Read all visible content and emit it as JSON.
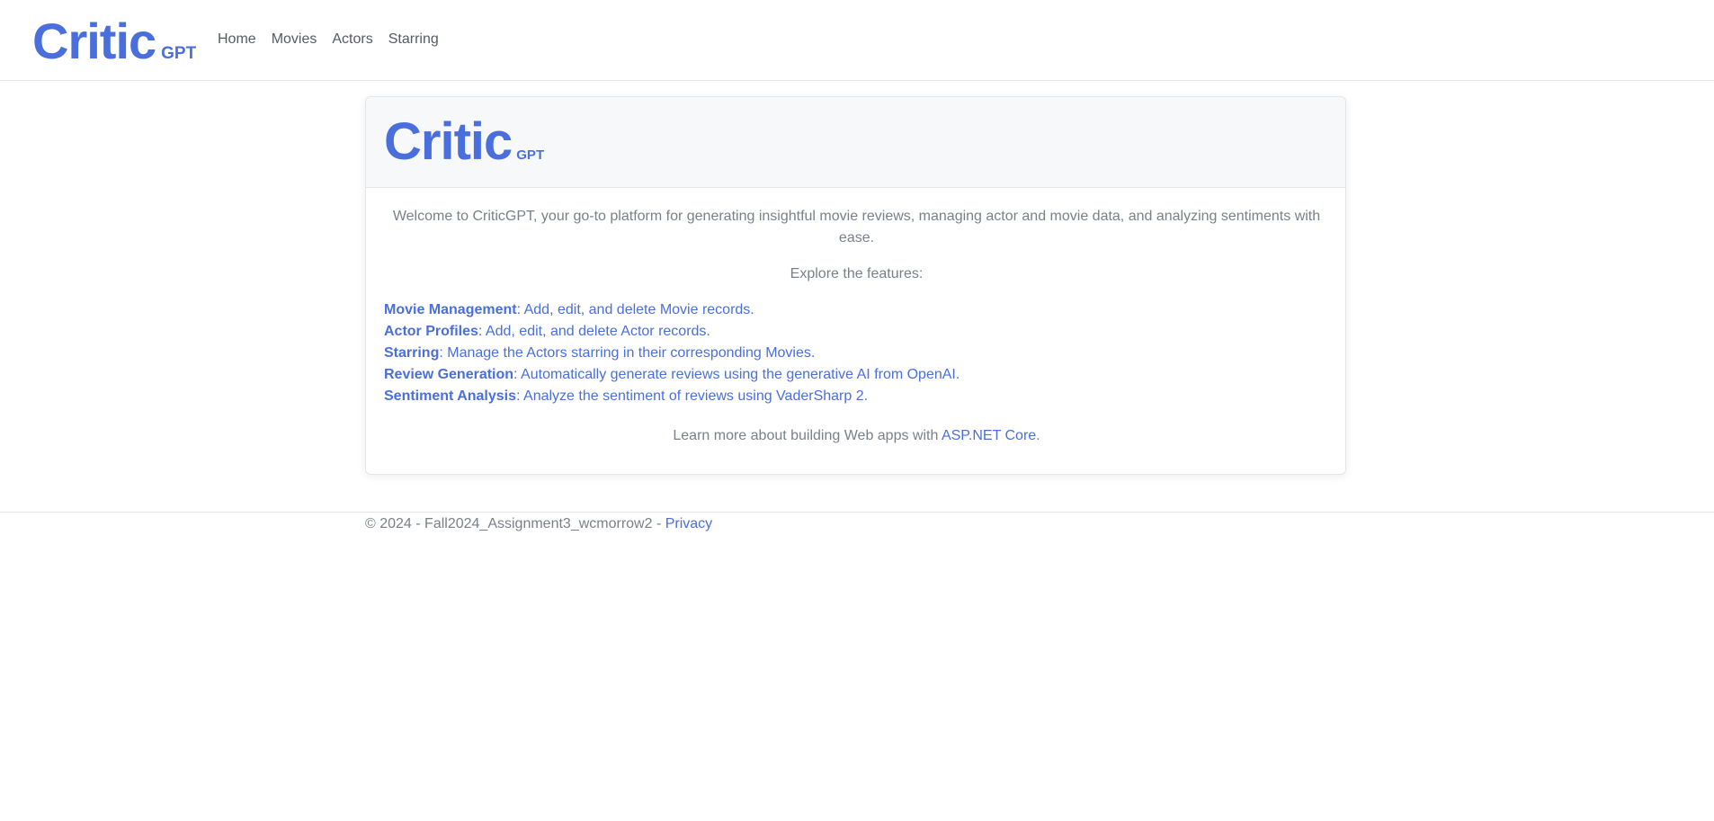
{
  "navbar": {
    "brand_main": "Critic",
    "brand_sub": "GPT",
    "links": [
      {
        "label": "Home"
      },
      {
        "label": "Movies"
      },
      {
        "label": "Actors"
      },
      {
        "label": "Starring"
      }
    ]
  },
  "card": {
    "brand_main": "Critic",
    "brand_sub": "GPT",
    "welcome": "Welcome to CriticGPT, your go-to platform for generating insightful movie reviews, managing actor and movie data, and analyzing sentiments with ease.",
    "explore": "Explore the features:",
    "features": [
      {
        "title": "Movie Management",
        "desc": ": Add, edit, and delete Movie records."
      },
      {
        "title": "Actor Profiles",
        "desc": ": Add, edit, and delete Actor records."
      },
      {
        "title": "Starring",
        "desc": ": Manage the Actors starring in their corresponding Movies."
      },
      {
        "title": "Review Generation",
        "desc": ": Automatically generate reviews using the generative AI from OpenAI."
      },
      {
        "title": "Sentiment Analysis",
        "desc": ": Analyze the sentiment of reviews using VaderSharp 2."
      }
    ],
    "learn_prefix": "Learn more about building Web apps with ",
    "learn_link": "ASP.NET Core",
    "learn_suffix": "."
  },
  "footer": {
    "text": "© 2024 - Fall2024_Assignment3_wcmorrow2 - ",
    "privacy_link": "Privacy"
  },
  "colors": {
    "accent": "#4a6fdc",
    "muted_text": "#7b8088",
    "header_bg": "#f7f8fa"
  }
}
